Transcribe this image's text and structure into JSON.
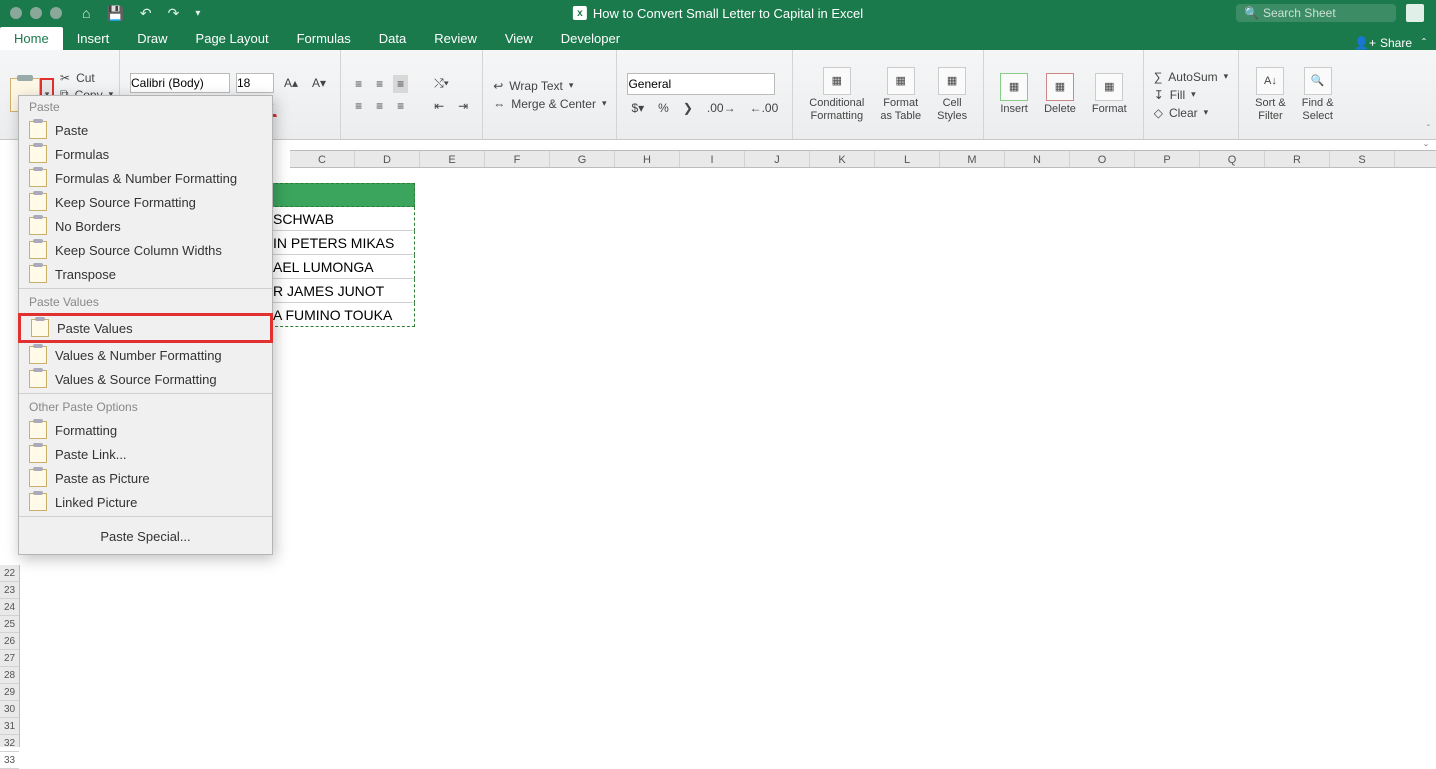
{
  "titlebar": {
    "title": "How to Convert Small Letter to Capital in Excel",
    "search_placeholder": "Search Sheet"
  },
  "tabs": {
    "items": [
      "Home",
      "Insert",
      "Draw",
      "Page Layout",
      "Formulas",
      "Data",
      "Review",
      "View",
      "Developer"
    ],
    "share": "Share"
  },
  "ribbon": {
    "cut": "Cut",
    "copy": "Copy",
    "font_name": "Calibri (Body)",
    "font_size": "18",
    "wrap": "Wrap Text",
    "merge": "Merge & Center",
    "number_format": "General",
    "cond": "Conditional\nFormatting",
    "fmt_table": "Format\nas Table",
    "cell_styles": "Cell\nStyles",
    "insert": "Insert",
    "delete": "Delete",
    "format": "Format",
    "autosum": "AutoSum",
    "fill": "Fill",
    "clear": "Clear",
    "sort": "Sort &\nFilter",
    "find": "Find &\nSelect"
  },
  "paste_menu": {
    "g1": "Paste",
    "items1": [
      "Paste",
      "Formulas",
      "Formulas & Number Formatting",
      "Keep Source Formatting",
      "No Borders",
      "Keep Source Column Widths",
      "Transpose"
    ],
    "g2": "Paste Values",
    "items2": [
      "Paste Values",
      "Values & Number Formatting",
      "Values & Source Formatting"
    ],
    "g3": "Other Paste Options",
    "items3": [
      "Formatting",
      "Paste Link...",
      "Paste as Picture",
      "Linked Picture"
    ],
    "special": "Paste Special..."
  },
  "columns": [
    "C",
    "D",
    "E",
    "F",
    "G",
    "H",
    "I",
    "J",
    "K",
    "L",
    "M",
    "N",
    "O",
    "P",
    "Q",
    "R",
    "S"
  ],
  "rows_visible": [
    "22",
    "23",
    "24",
    "25",
    "26",
    "27",
    "28",
    "29",
    "30",
    "31",
    "32",
    "33"
  ],
  "data_cells": [
    " SCHWAB",
    "IN PETERS MIKAS",
    "AEL LUMONGA",
    "R JAMES JUNOT",
    "A FUMINO TOUKA"
  ]
}
